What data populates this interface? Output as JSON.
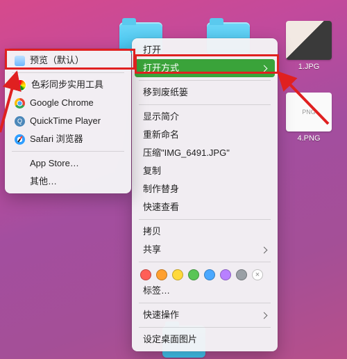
{
  "desktop": {
    "files": [
      {
        "label": "1.JPG"
      },
      {
        "label": "4.PNG"
      }
    ]
  },
  "context_menu": {
    "items": {
      "open": "打开",
      "open_with": "打开方式",
      "move_to_trash": "移到废纸篓",
      "get_info": "显示简介",
      "rename": "重新命名",
      "compress": "压缩\"IMG_6491.JPG\"",
      "duplicate": "复制",
      "make_alias": "制作替身",
      "quick_look": "快速查看",
      "copy": "拷贝",
      "share": "共享",
      "tags": "标签…",
      "quick_actions": "快速操作",
      "set_desktop": "设定桌面图片"
    }
  },
  "open_with": {
    "default_app": "预览（默认）",
    "apps": {
      "colorsync": "色彩同步实用工具",
      "chrome": "Google Chrome",
      "quicktime": "QuickTime Player",
      "safari": "Safari 浏览器"
    },
    "app_store": "App Store…",
    "other": "其他…"
  }
}
